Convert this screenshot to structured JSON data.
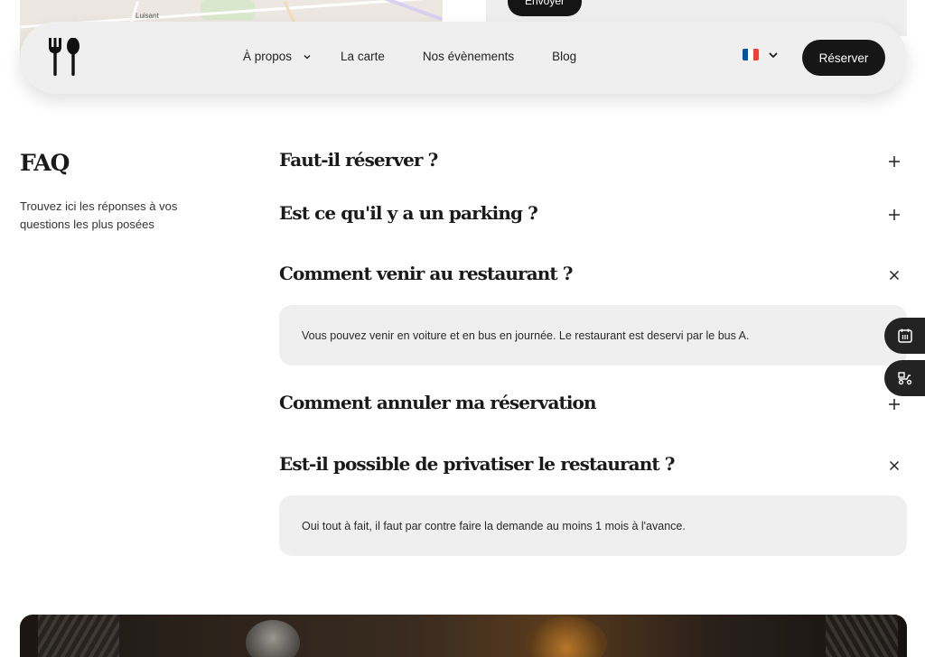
{
  "map": {
    "label": "Luisant"
  },
  "form": {
    "send_label": "Envoyer"
  },
  "nav": {
    "items": [
      {
        "label": "À propos"
      },
      {
        "label": "La carte"
      },
      {
        "label": "Nos évènements"
      },
      {
        "label": "Blog"
      }
    ],
    "language_flag": "fr-flag-icon",
    "reserve_label": "Réserver"
  },
  "faq": {
    "title": "FAQ",
    "subtitle": "Trouvez ici les réponses à vos questions les plus posées",
    "items": [
      {
        "question": "Faut-il réserver ?",
        "open": false,
        "answer": ""
      },
      {
        "question": "Est ce qu'il y a un parking ?",
        "open": false,
        "answer": ""
      },
      {
        "question": "Comment venir au restaurant ?",
        "open": true,
        "answer": "Vous pouvez venir en voiture et en bus en journée. Le restaurant est deservi par le bus A."
      },
      {
        "question": "Comment annuler ma réservation",
        "open": false,
        "answer": ""
      },
      {
        "question": "Est-il possible de privatiser le restaurant ?",
        "open": true,
        "answer": "Oui tout à fait, il faut par contre faire la demande au moins 1 mois à l'avance."
      }
    ]
  },
  "side_tabs": [
    {
      "icon": "calendar-icon"
    },
    {
      "icon": "delivery-scooter-icon"
    }
  ],
  "colors": {
    "dark": "#161616",
    "panel": "#efefef",
    "accent_blue": "#0055a4",
    "accent_red": "#ef4135"
  }
}
